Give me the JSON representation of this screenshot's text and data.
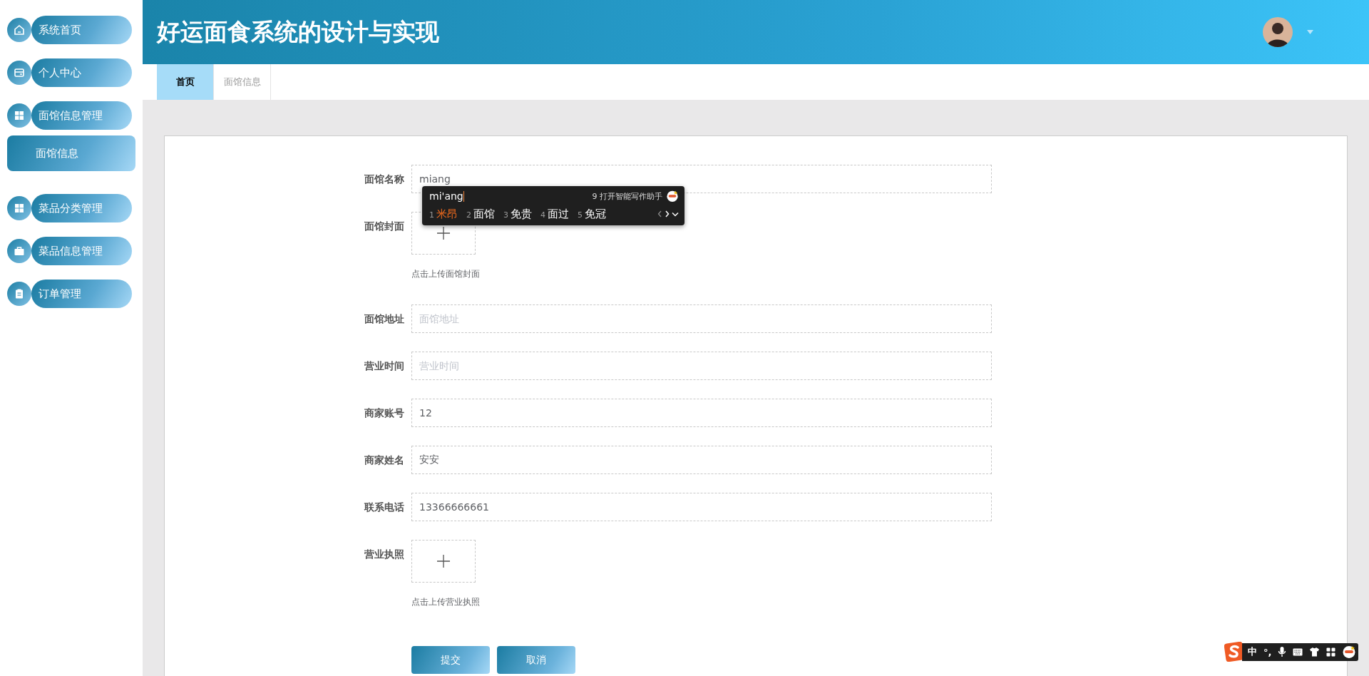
{
  "sidebar": {
    "items": [
      {
        "label": "系统首页"
      },
      {
        "label": "个人中心"
      },
      {
        "label": "面馆信息管理",
        "children": [
          {
            "label": "面馆信息"
          }
        ]
      },
      {
        "label": "菜品分类管理"
      },
      {
        "label": "菜品信息管理"
      },
      {
        "label": "订单管理"
      }
    ]
  },
  "header": {
    "title": "好运面食系统的设计与实现"
  },
  "tabs": [
    {
      "label": "首页",
      "selected": true
    },
    {
      "label": "面馆信息",
      "selected": false
    }
  ],
  "form": {
    "fields": [
      {
        "kind": "text",
        "label": "面馆名称",
        "value": "miang"
      },
      {
        "kind": "upload",
        "label": "面馆封面",
        "hint": "点击上传面馆封面"
      },
      {
        "kind": "text",
        "label": "面馆地址",
        "placeholder": "面馆地址"
      },
      {
        "kind": "text",
        "label": "营业时间",
        "placeholder": "营业时间"
      },
      {
        "kind": "text",
        "label": "商家账号",
        "value": "12"
      },
      {
        "kind": "text",
        "label": "商家姓名",
        "value": "安安"
      },
      {
        "kind": "text",
        "label": "联系电话",
        "value": "13366666661"
      },
      {
        "kind": "upload",
        "label": "营业执照",
        "hint": "点击上传营业执照"
      }
    ],
    "buttons": [
      {
        "label": "提交"
      },
      {
        "label": "取消"
      }
    ]
  },
  "ime_popup": {
    "composition": "mi'ang",
    "assist": {
      "index": "9",
      "text": "打开智能写作助手"
    },
    "candidates": [
      {
        "index": "1",
        "text": "米昂",
        "selected": true
      },
      {
        "index": "2",
        "text": "面馆",
        "selected": false
      },
      {
        "index": "3",
        "text": "免贵",
        "selected": false
      },
      {
        "index": "4",
        "text": "面过",
        "selected": false
      },
      {
        "index": "5",
        "text": "免冠",
        "selected": false
      }
    ]
  },
  "ime_toolbar": {
    "items": [
      "中",
      "°,"
    ]
  }
}
